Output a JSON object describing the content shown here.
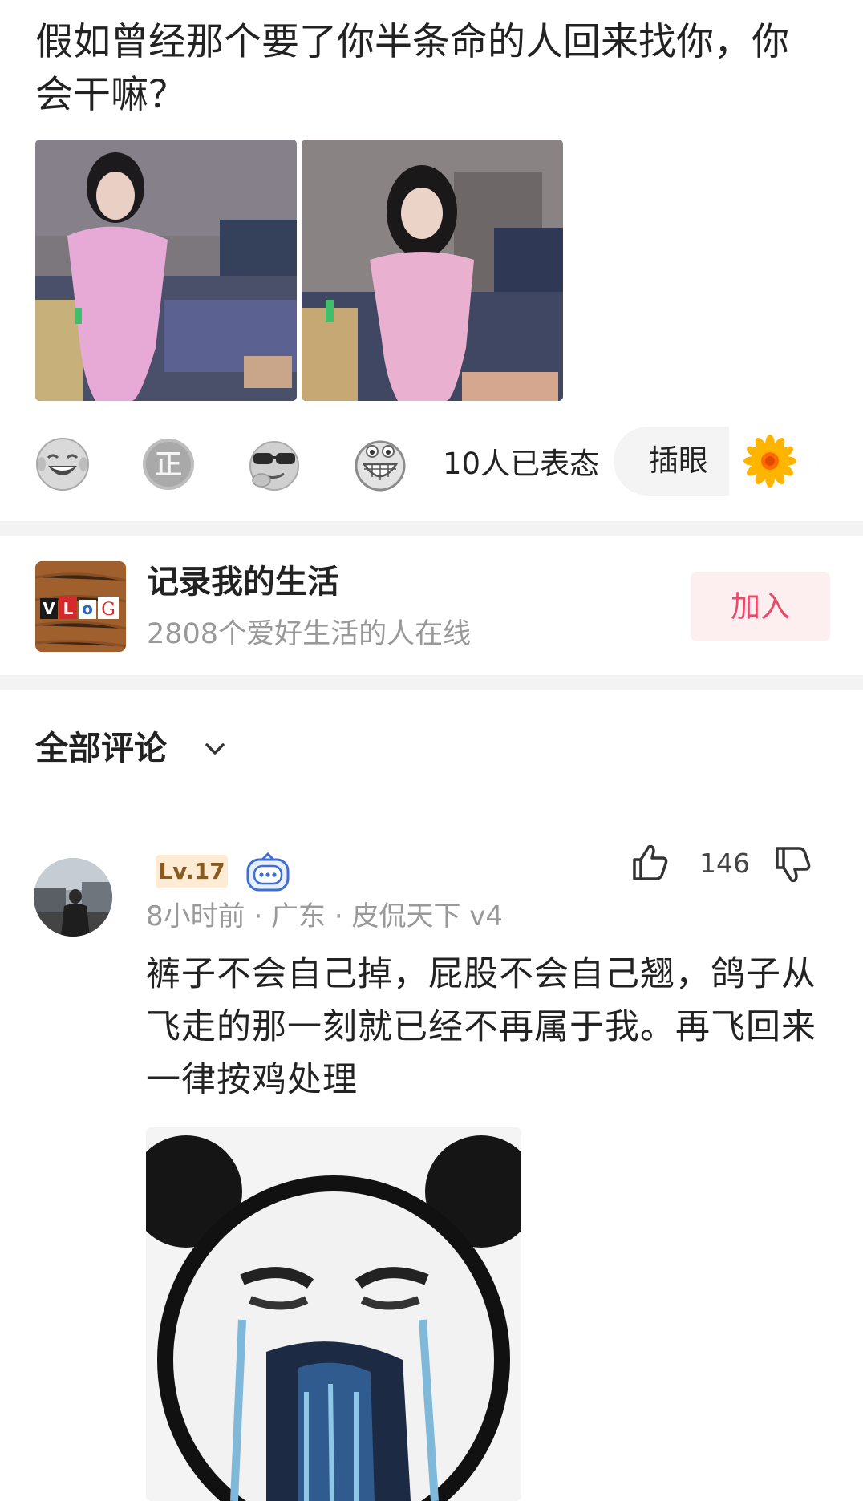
{
  "post": {
    "title": "假如曾经那个要了你半条命的人回来找你，你会干嘛？",
    "images": [
      "photo-1",
      "photo-2"
    ]
  },
  "reactions": {
    "emojis": [
      "laughing-tears-emoji",
      "zheng-emoji",
      "sunglasses-emoji",
      "grinning-emoji"
    ],
    "count_text": "10人已表态",
    "pill_label": "插眼",
    "pill_icon": "sunflower-icon"
  },
  "circle": {
    "logo_text": "VLOG",
    "name": "记录我的生活",
    "subtitle": "2808个爱好生活的人在线",
    "join_label": "加入"
  },
  "comments_header": {
    "title": "全部评论",
    "icon": "chevron-down-icon"
  },
  "comment": {
    "level": "Lv.17",
    "meta": "8小时前 · 广东 · 皮侃天下 v4",
    "likes": "146",
    "text": "裤子不会自己掉，屁股不会自己翘，鸽子从飞走的那一刻就已经不再属于我。再飞回来一律按鸡处理",
    "sticker": "crying-panda-sticker"
  },
  "colors": {
    "join_text": "#e84a6a",
    "join_bg": "#fdeef0",
    "level_bg": "#fdecd3",
    "level_text": "#8a5a1e",
    "secondary_text": "#999999",
    "separator": "#f3f3f3"
  }
}
